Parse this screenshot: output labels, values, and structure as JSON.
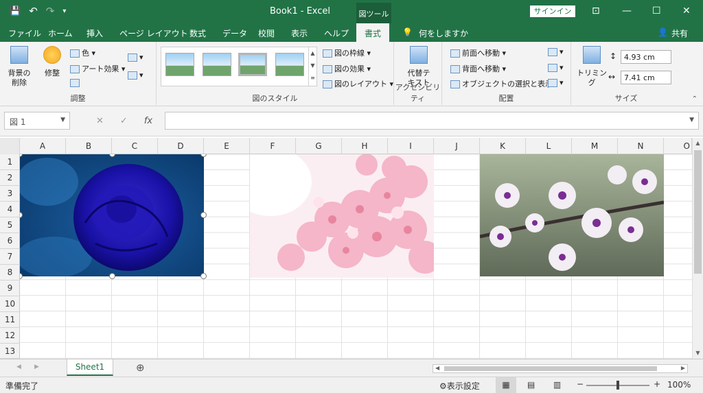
{
  "title": {
    "doc": "Book1",
    "sep": "-",
    "app": "Excel",
    "context_tab": "図ツール",
    "signin": "サインイン"
  },
  "qat": {
    "save_icon": "💾",
    "undo_icon": "↶",
    "redo_icon": "↷",
    "customize_icon": "▾"
  },
  "window": {
    "ribbon_opts": "⊡",
    "minimize": "—",
    "restore": "☐",
    "close": "✕"
  },
  "tabs": [
    {
      "label": "ファイル"
    },
    {
      "label": "ホーム"
    },
    {
      "label": "挿入"
    },
    {
      "label": "ページ レイアウト"
    },
    {
      "label": "数式"
    },
    {
      "label": "データ"
    },
    {
      "label": "校閲"
    },
    {
      "label": "表示"
    },
    {
      "label": "ヘルプ"
    },
    {
      "label": "書式"
    }
  ],
  "tellme": "何をしますか",
  "share": "共有",
  "ribbon": {
    "remove_bg": "背景の\n削除",
    "corrections": "修整",
    "color": "色",
    "art_effects": "アート効果",
    "group_adjust": "調整",
    "border": "図の枠線",
    "effects": "図の効果",
    "layout": "図のレイアウト",
    "group_styles": "図のスタイル",
    "alt_text": "代替テ\nキスト",
    "group_access": "アクセシビリティ",
    "bring_forward": "前面へ移動",
    "send_backward": "背面へ移動",
    "selection_pane": "オブジェクトの選択と表示",
    "group_arrange": "配置",
    "crop": "トリミング",
    "height": "4.93 cm",
    "width": "7.41 cm",
    "group_size": "サイズ"
  },
  "namebox": "図 1",
  "fx": {
    "cancel": "✕",
    "enter": "✓",
    "fx": "fx"
  },
  "columns": [
    "A",
    "B",
    "C",
    "D",
    "E",
    "F",
    "G",
    "H",
    "I",
    "J",
    "K",
    "L",
    "M",
    "N",
    "O"
  ],
  "rows": [
    "1",
    "2",
    "3",
    "4",
    "5",
    "6",
    "7",
    "8",
    "9",
    "10",
    "11",
    "12",
    "13"
  ],
  "sheet": {
    "name": "Sheet1",
    "add": "⊕"
  },
  "status": {
    "ready": "準備完了",
    "display_settings": "表示設定",
    "zoom": "100%",
    "minus": "−",
    "plus": "+"
  },
  "colors": {
    "accent": "#217346"
  }
}
